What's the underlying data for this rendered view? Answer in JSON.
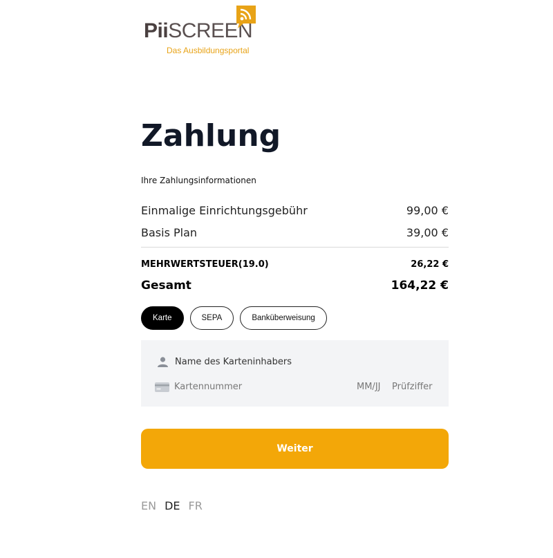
{
  "logo": {
    "brand_bold": "Pii",
    "brand_rest": "SCREEN",
    "tagline": "Das Ausbildungsportal",
    "accent_color": "#e8a317",
    "icon": "rss-speech-bubble-icon"
  },
  "page": {
    "title": "Zahlung",
    "subtitle": "Ihre Zahlungsinformationen"
  },
  "summary": {
    "items": [
      {
        "label": "Einmalige Einrichtungsgebühr",
        "amount": "99,00 €"
      },
      {
        "label": "Basis Plan",
        "amount": "39,00 €"
      }
    ],
    "tax": {
      "label": "MEHRWERTSTEUER(19.0)",
      "amount": "26,22 €"
    },
    "total": {
      "label": "Gesamt",
      "amount": "164,22 €"
    }
  },
  "payment_methods": {
    "options": [
      "Karte",
      "SEPA",
      "Banküberweisung"
    ],
    "selected": "Karte"
  },
  "card_form": {
    "holder_placeholder": "Name des Karteninhabers",
    "holder_icon": "person-icon",
    "number_placeholder": "Kartennummer",
    "number_icon": "credit-card-icon",
    "expiry_placeholder": "MM/JJ",
    "cvc_placeholder": "Prüfziffer"
  },
  "submit": {
    "label": "Weiter",
    "color": "#f3a708"
  },
  "languages": {
    "options": [
      "EN",
      "DE",
      "FR"
    ],
    "current": "DE"
  }
}
